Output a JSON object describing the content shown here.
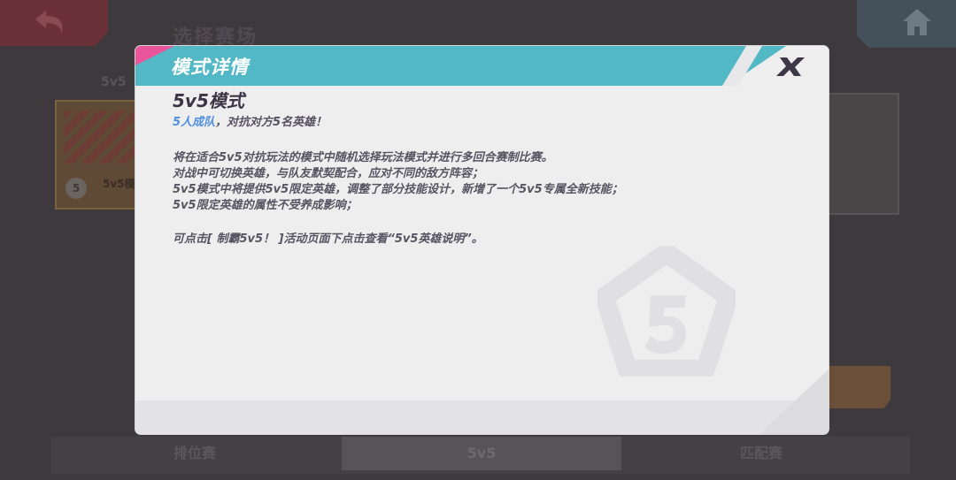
{
  "background": {
    "page_title": "选择赛场",
    "mode_tab_label": "5v5",
    "tile_badge": "5",
    "tile_text": "5v5模",
    "bottom_tabs": [
      "排位赛",
      "5v5",
      "匹配赛"
    ]
  },
  "modal": {
    "title": "模式详情",
    "mode_name": "5v5模式",
    "subtitle_highlight": "5人成队",
    "subtitle_rest": "，对抗对方5名英雄！",
    "description": [
      "将在适合5v5对抗玩法的模式中随机选择玩法模式并进行多回合赛制比赛。",
      "对战中可切换英雄，与队友默契配合，应对不同的敌方阵容；",
      "5v5模式中将提供5v5限定英雄，调整了部分技能设计，新增了一个5v5专属全新技能；",
      "5v5限定英雄的属性不受养成影响；"
    ],
    "note": "可点击[ 制霸5v5！ ]活动页面下点击查看“5v5英雄说明”。",
    "close_icon": "close-x-icon",
    "watermark_icon": "pentagon-5-emblem",
    "colors": {
      "header": "#52b8c6",
      "accent_pink": "#e9549a",
      "highlight": "#4f8fe0",
      "panel": "#eeeeef"
    }
  }
}
